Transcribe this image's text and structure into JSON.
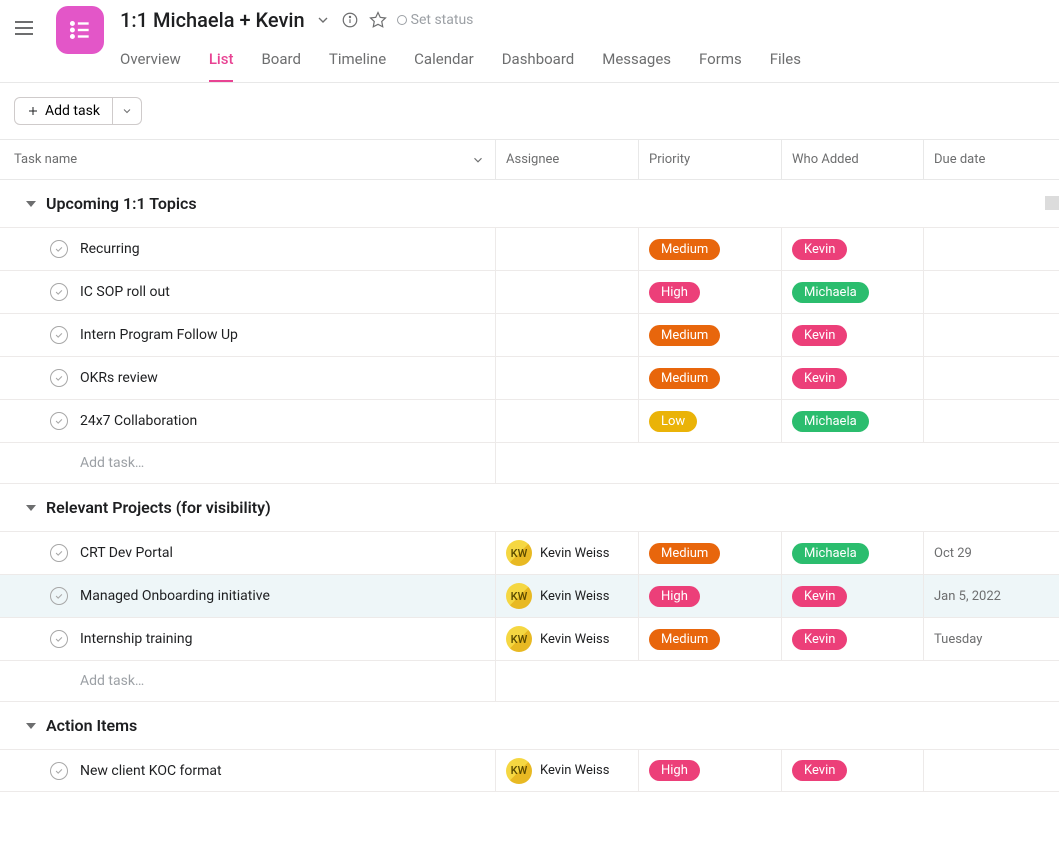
{
  "header": {
    "title": "1:1 Michaela + Kevin",
    "status_placeholder": "Set status",
    "tabs": [
      "Overview",
      "List",
      "Board",
      "Timeline",
      "Calendar",
      "Dashboard",
      "Messages",
      "Forms",
      "Files"
    ],
    "active_tab": "List"
  },
  "toolbar": {
    "add_task_label": "Add task"
  },
  "columns": {
    "task": "Task name",
    "assignee": "Assignee",
    "priority": "Priority",
    "who": "Who Added",
    "due": "Due date"
  },
  "sections": [
    {
      "title": "Upcoming 1:1 Topics",
      "tasks": [
        {
          "name": "Recurring",
          "assignee": null,
          "priority": "Medium",
          "who": "Kevin",
          "due": ""
        },
        {
          "name": "IC SOP roll out",
          "assignee": null,
          "priority": "High",
          "who": "Michaela",
          "due": ""
        },
        {
          "name": "Intern Program Follow Up",
          "assignee": null,
          "priority": "Medium",
          "who": "Kevin",
          "due": ""
        },
        {
          "name": "OKRs review",
          "assignee": null,
          "priority": "Medium",
          "who": "Kevin",
          "due": ""
        },
        {
          "name": "24x7 Collaboration",
          "assignee": null,
          "priority": "Low",
          "who": "Michaela",
          "due": ""
        }
      ],
      "add_placeholder": "Add task…"
    },
    {
      "title": "Relevant Projects (for visibility)",
      "tasks": [
        {
          "name": "CRT Dev Portal",
          "assignee": {
            "initials": "KW",
            "name": "Kevin Weiss"
          },
          "priority": "Medium",
          "who": "Michaela",
          "due": "Oct 29"
        },
        {
          "name": "Managed Onboarding initiative",
          "assignee": {
            "initials": "KW",
            "name": "Kevin Weiss"
          },
          "priority": "High",
          "who": "Kevin",
          "due": "Jan 5, 2022",
          "highlight": true
        },
        {
          "name": "Internship training",
          "assignee": {
            "initials": "KW",
            "name": "Kevin Weiss"
          },
          "priority": "Medium",
          "who": "Kevin",
          "due": "Tuesday"
        }
      ],
      "add_placeholder": "Add task…"
    },
    {
      "title": "Action Items",
      "tasks": [
        {
          "name": "New client KOC format",
          "assignee": {
            "initials": "KW",
            "name": "Kevin Weiss"
          },
          "priority": "High",
          "who": "Kevin",
          "due": ""
        }
      ]
    }
  ]
}
